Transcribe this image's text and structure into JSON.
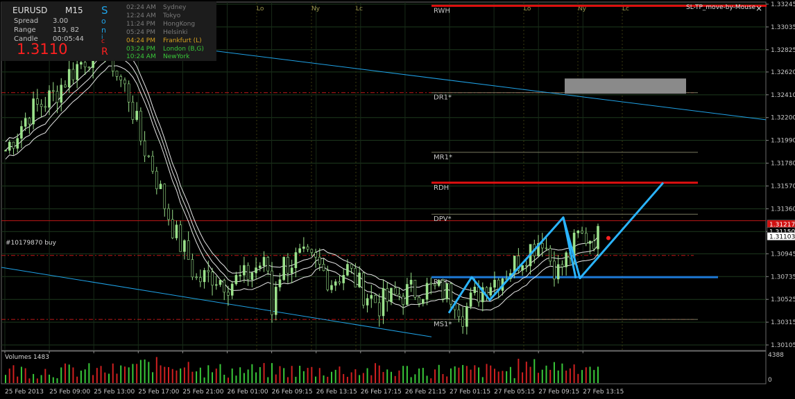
{
  "colors": {
    "background": "#000000",
    "bull_candle": "#9be28b",
    "bear_candle": "#000000",
    "grid": "#1e3a1e",
    "channel": "#1fa3e8",
    "red_level": "#e01010",
    "zigzag": "#2ab4ff",
    "text_red": "#ff2020"
  },
  "info_panel": {
    "symbol": "EURUSD",
    "timeframe": "M15",
    "spread_label": "Spread",
    "spread_value": "3.00",
    "range_label": "Range",
    "range_value": "119, 82",
    "candle_label": "Candle",
    "candle_value": "00:05:44",
    "price": "1.3110",
    "side_letters": [
      "S",
      "o",
      "n",
      "i",
      "c",
      "R"
    ]
  },
  "sessions": [
    {
      "time": "02:24 AM",
      "city": "Sydney",
      "color": "#7a7a7a"
    },
    {
      "time": "12:24 AM",
      "city": "Tokyo",
      "color": "#7a7a7a"
    },
    {
      "time": "11:24 PM",
      "city": "HongKong",
      "color": "#7a7a7a"
    },
    {
      "time": "05:24 PM",
      "city": "Helsinki",
      "color": "#7a7a7a"
    },
    {
      "time": "04:24 PM",
      "city": "Frankfurt  (L)",
      "color": "#d4a020"
    },
    {
      "time": "03:24 PM",
      "city": "London  (B,G)",
      "color": "#39c839"
    },
    {
      "time": "10:24 AM",
      "city": "NewYork",
      "color": "#39c839"
    }
  ],
  "indicator_title": "SL-TP_move-by-Mouse",
  "close_glyph": "×",
  "chart_data": {
    "type": "candlestick",
    "symbol": "EURUSD",
    "timeframe": "M15",
    "y_ticks": [
      "1.33245",
      "1.33035",
      "1.32825",
      "1.32620",
      "1.32410",
      "1.32200",
      "1.31990",
      "1.31780",
      "1.31570",
      "1.31360",
      "1.31150",
      "1.30945",
      "1.30735",
      "1.30525",
      "1.30315",
      "1.30105"
    ],
    "ylim": [
      1.30105,
      1.33245
    ],
    "x_ticks": [
      "25 Feb 2013",
      "25 Feb 09:00",
      "25 Feb 13:00",
      "25 Feb 17:00",
      "25 Feb 21:00",
      "26 Feb 01:00",
      "26 Feb 09:15",
      "26 Feb 13:15",
      "26 Feb 17:15",
      "26 Feb 21:15",
      "27 Feb 01:15",
      "27 Feb 05:15",
      "27 Feb 09:15",
      "27 Feb 13:15"
    ],
    "price_series": [
      [
        0,
        1.319
      ],
      [
        6,
        1.3225
      ],
      [
        12,
        1.324
      ],
      [
        16,
        1.326
      ],
      [
        20,
        1.3275
      ],
      [
        24,
        1.3286
      ],
      [
        26,
        1.3282
      ],
      [
        28,
        1.326
      ],
      [
        31,
        1.324
      ],
      [
        34,
        1.32
      ],
      [
        37,
        1.3175
      ],
      [
        40,
        1.314
      ],
      [
        43,
        1.311
      ],
      [
        46,
        1.309
      ],
      [
        48,
        1.307
      ],
      [
        52,
        1.3075
      ],
      [
        56,
        1.3068
      ],
      [
        60,
        1.3072
      ],
      [
        64,
        1.3085
      ],
      [
        66,
        1.308
      ],
      [
        67,
        1.304
      ],
      [
        68,
        1.307
      ],
      [
        70,
        1.3085
      ],
      [
        74,
        1.309
      ],
      [
        78,
        1.3085
      ],
      [
        82,
        1.307
      ],
      [
        86,
        1.308
      ],
      [
        90,
        1.306
      ],
      [
        94,
        1.3048
      ],
      [
        98,
        1.3055
      ],
      [
        102,
        1.306
      ],
      [
        106,
        1.3062
      ],
      [
        110,
        1.306
      ],
      [
        113,
        1.3055
      ],
      [
        115,
        1.304
      ],
      [
        118,
        1.3055
      ],
      [
        121,
        1.3068
      ],
      [
        124,
        1.3072
      ],
      [
        128,
        1.3085
      ],
      [
        132,
        1.31
      ],
      [
        135,
        1.311
      ],
      [
        137,
        1.309
      ],
      [
        139,
        1.3078
      ],
      [
        142,
        1.3095
      ],
      [
        144,
        1.311
      ]
    ],
    "pivot_levels": [
      {
        "label": "RWH",
        "value": 1.3323
      },
      {
        "label": "DR1*",
        "value": 1.3243
      },
      {
        "label": "MR1*",
        "value": 1.3188
      },
      {
        "label": "RDH",
        "value": 1.316
      },
      {
        "label": "DPV*",
        "value": 1.3131
      },
      {
        "label": "RWL",
        "value": 1.3073
      },
      {
        "label": "MS1*",
        "value": 1.3034
      }
    ],
    "price_markers": [
      "1.31217",
      "1.31150",
      "1.31103"
    ],
    "order_label": "#10179870 buy",
    "session_markers": [
      "Lo",
      "Ny",
      "Lc",
      "Lo",
      "Ny",
      "Lc"
    ],
    "volume_panel": {
      "label": "Volumes 1483",
      "y_ticks": [
        "4388",
        "0"
      ]
    }
  }
}
